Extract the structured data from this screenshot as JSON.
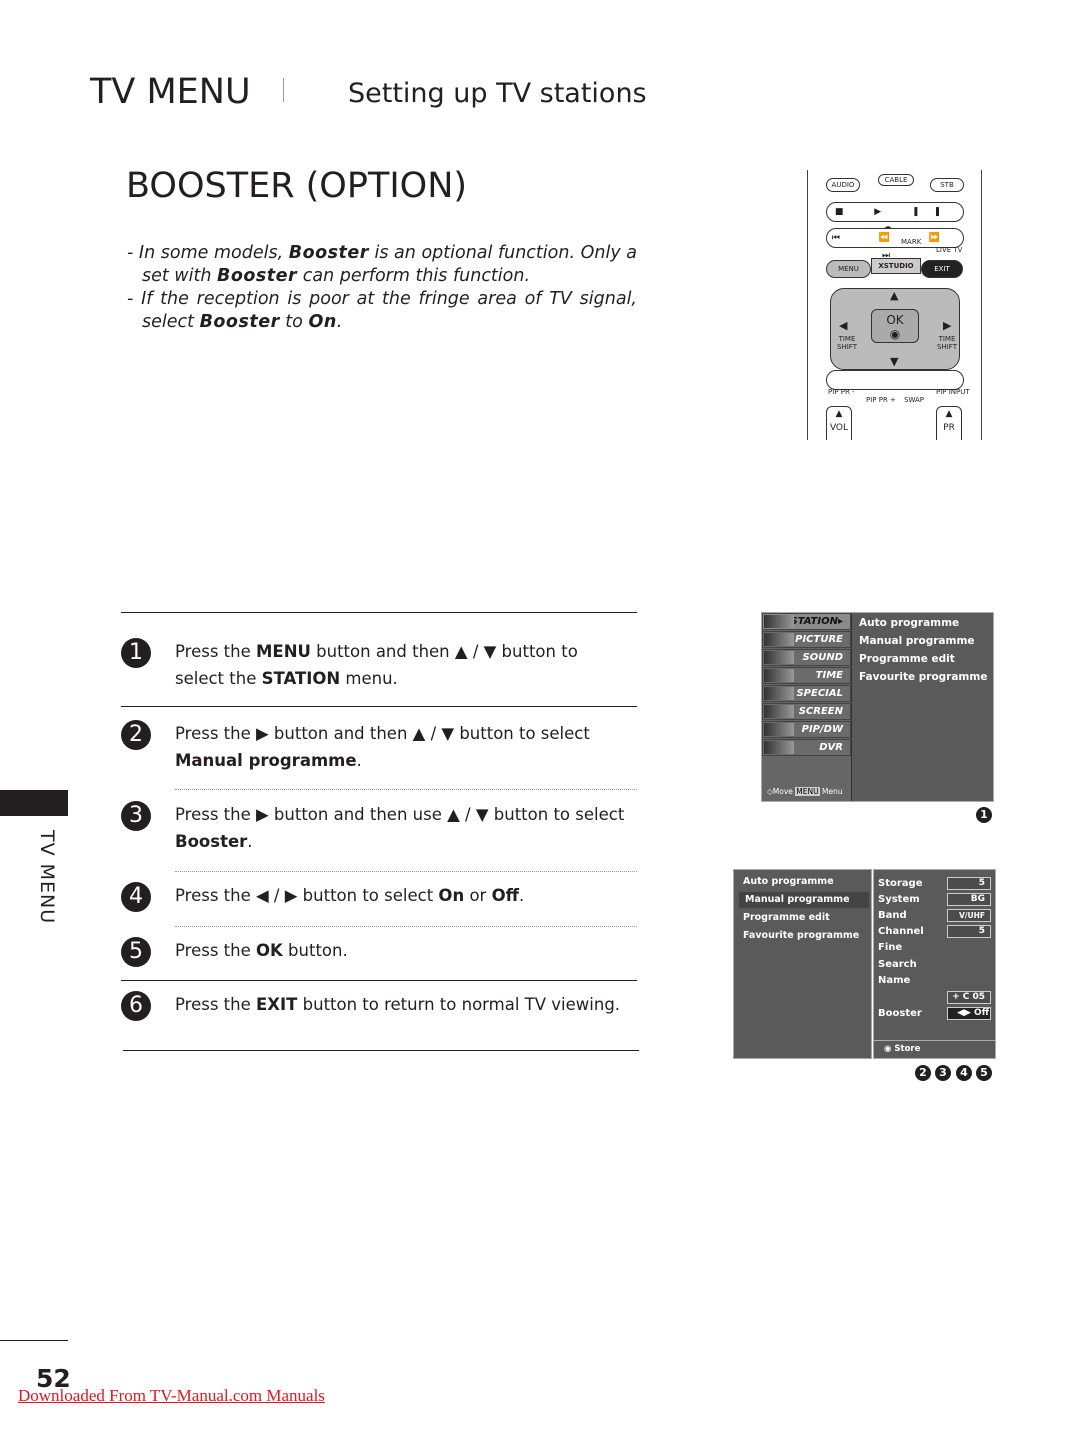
{
  "header": {
    "section": "TV MENU",
    "subtitle": "Setting up TV stations"
  },
  "title": "BOOSTER (OPTION)",
  "notes": [
    {
      "parts": [
        "In some models, ",
        "Booster",
        " is an optional function. Only a set with ",
        "Booster",
        " can perform this function."
      ]
    },
    {
      "parts": [
        "If the reception is poor at the fringe area of TV signal, select ",
        "Booster",
        " to ",
        "On",
        "."
      ]
    }
  ],
  "steps": [
    {
      "num": "1",
      "a": "Press the ",
      "b": "MENU",
      "c": " button and then ▲ / ▼ button to select the ",
      "d": "STATION",
      "e": " menu."
    },
    {
      "num": "2",
      "a": "Press the ▶ button and then ▲ / ▼ button to select ",
      "b": "Manual programme",
      "c": "."
    },
    {
      "num": "3",
      "a": "Press the ▶ button and then use ▲ / ▼ button to select ",
      "b": "Booster",
      "c": "."
    },
    {
      "num": "4",
      "a": "Press the ◀ / ▶ button to select ",
      "b": "On",
      "c": " or ",
      "d": "Off",
      "e": "."
    },
    {
      "num": "5",
      "a": "Press the ",
      "b": "OK",
      "c": " button."
    },
    {
      "num": "6",
      "a": "Press the ",
      "b": "EXIT",
      "c": " button to return to normal TV viewing."
    }
  ],
  "side_tab": "TV MENU",
  "page_number": "52",
  "download_link": "Downloaded From TV-Manual.com Manuals",
  "remote": {
    "buttons": [
      "AUDIO",
      "CABLE",
      "STB",
      "MARK",
      "LIVE TV",
      "MENU",
      "XSTUDIO",
      "EXIT",
      "OK",
      "TIME SHIFT",
      "TIME SHIFT",
      "PIP PR -",
      "PIP PR +",
      "SWAP",
      "PIP INPUT",
      "VOL",
      "PR"
    ]
  },
  "osd1": {
    "menu": [
      "STATION",
      "PICTURE",
      "SOUND",
      "TIME",
      "SPECIAL",
      "SCREEN",
      "PIP/DW",
      "DVR"
    ],
    "submenu": [
      "Auto programme",
      "Manual programme",
      "Programme edit",
      "Favourite programme"
    ],
    "footer_move": "Move",
    "footer_menu_key": "MENU",
    "footer_menu": "Menu",
    "marker": "1"
  },
  "osd2": {
    "menu": [
      "Auto programme",
      "Manual programme",
      "Programme edit",
      "Favourite programme"
    ],
    "labels": [
      "Storage",
      "System",
      "Band",
      "Channel",
      "Fine",
      "Search",
      "Name",
      "Booster"
    ],
    "values": {
      "storage": "5",
      "system": "BG",
      "band": "V/UHF",
      "channel": "5",
      "name": "+ C 05",
      "booster": "◀▶ Off"
    },
    "store": "Store",
    "markers": [
      "2",
      "3",
      "4",
      "5"
    ]
  }
}
